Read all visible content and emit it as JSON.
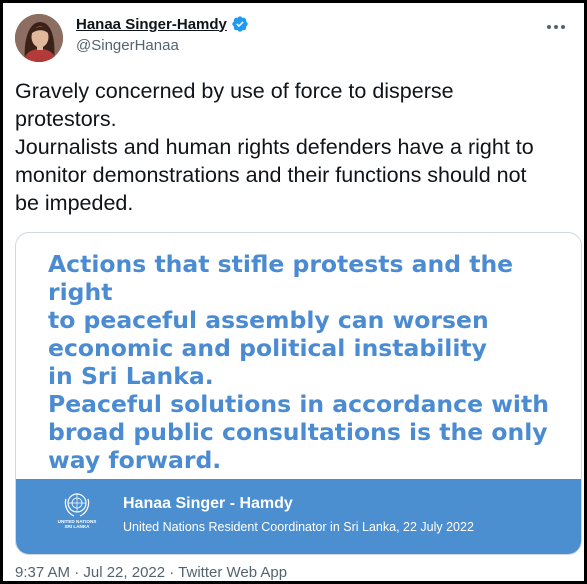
{
  "author": {
    "name": "Hanaa Singer-Hamdy",
    "handle": "@SingerHanaa",
    "avatar_icon": "profile-photo",
    "verified_icon": "verified-badge-icon"
  },
  "tweet": {
    "text": "Gravely concerned by use of force to disperse\nprotestors.\nJournalists and human rights defenders have a right to\nmonitor demonstrations and their functions should not\nbe impeded."
  },
  "media": {
    "headline": "Actions that stifle protests and the right\nto peaceful assembly can worsen\neconomic and political instability\nin Sri Lanka.\nPeaceful solutions in accordance with\nbroad public consultations is the only\nway forward.",
    "logo_label_line1": "UNITED NATIONS",
    "logo_label_line2": "SRI LANKA",
    "signature_name": "Hanaa Singer - Hamdy",
    "signature_title": "United Nations Resident Coordinator in Sri Lanka, 22 July 2022",
    "headline_color": "#4a8bd2",
    "bar_color": "#4b8fd1"
  },
  "meta": {
    "timestamp": "9:37 AM · Jul 22, 2022 · Twitter Web App"
  },
  "colors": {
    "verified": "#1d9bf0",
    "secondary_text": "#536471"
  }
}
